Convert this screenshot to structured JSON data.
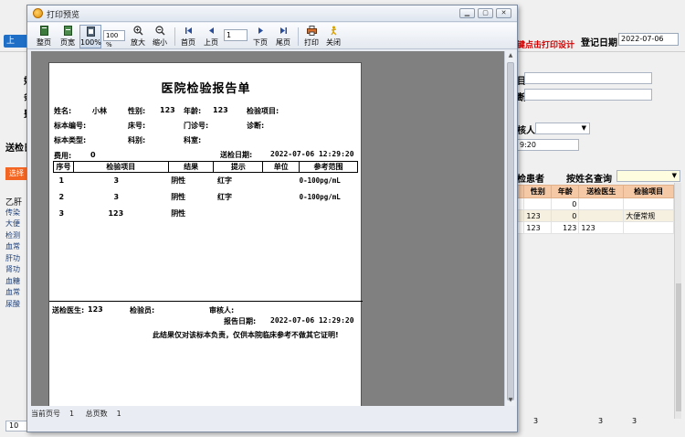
{
  "background": {
    "back_button": "上",
    "hint_text": "键点击打印设计",
    "register_date_label": "登记日期",
    "register_date_value": "2022-07-06",
    "time_value": "9:20",
    "left_header": "选择",
    "left_items": [
      "乙肝",
      "传染",
      "大便",
      "检测",
      "血常",
      "肝功",
      "肾功",
      "血糖",
      "血常",
      "尿酸"
    ],
    "pager_value": "10",
    "query_label_1": "检患者",
    "query_label_2": "按姓名查询",
    "grid_headers": [
      "",
      "性别",
      "年龄",
      "送检医生",
      "检验项目"
    ],
    "grid_rows": [
      [
        "",
        "",
        "0",
        "",
        ""
      ],
      [
        "",
        "123",
        "0",
        "",
        "大便常规"
      ],
      [
        "",
        "123",
        "123",
        "123",
        ""
      ]
    ],
    "bottom_values": [
      "3",
      "3",
      "3"
    ],
    "fragments": {
      "left_col": [
        "姓",
        "条",
        "费"
      ],
      "right_col": [
        "目",
        "断"
      ],
      "mid": "核人",
      "send_label": "送检日"
    }
  },
  "window": {
    "title": "打印预览",
    "buttons": {
      "minimize": "▁",
      "maximize": "▢",
      "close": "✕"
    },
    "toolbar": {
      "whole_page": "整页",
      "page_width": "页宽",
      "hundred": "100%",
      "zoom_value": "100 %",
      "zoom_in": "放大",
      "zoom_out": "缩小",
      "first_page": "首页",
      "prev_page": "上页",
      "page_number": "1",
      "next_page": "下页",
      "last_page": "尾页",
      "print": "打印",
      "close": "关闭"
    },
    "status": {
      "current_page": "当前页号",
      "current_page_value": "1",
      "total_pages": "总页数",
      "total_pages_value": "1"
    }
  },
  "report": {
    "title": "医院检验报告单",
    "name_label": "姓名:",
    "name_value": "小林",
    "gender_label": "性别:",
    "gender_value": "123",
    "age_label": "年龄:",
    "age_value": "123",
    "items_label": "检验项目:",
    "sample_no_label": "标本编号:",
    "bed_label": "床号:",
    "clinic_label": "门诊号:",
    "diagnosis_label": "诊断:",
    "sample_type_label": "标本类型:",
    "dept_label": "科别:",
    "room_label": "科室:",
    "fee_label": "费用:",
    "fee_value": "0",
    "send_date_label": "送检日期:",
    "send_date_value": "2022-07-06 12:29:20",
    "table_headers": [
      "序号",
      "检验项目",
      "结果",
      "提示",
      "单位",
      "参考范围"
    ],
    "table_rows": [
      [
        "1",
        "3",
        "阴性",
        "红字",
        "",
        "0-100pg/mL"
      ],
      [
        "2",
        "3",
        "阴性",
        "红字",
        "",
        "0-100pg/mL"
      ],
      [
        "3",
        "123",
        "阴性",
        "",
        "",
        ""
      ]
    ],
    "send_doctor_label": "送检医生:",
    "send_doctor_value": "123",
    "inspector_label": "检验员:",
    "reviewer_label": "审核人:",
    "report_date_label": "报告日期:",
    "report_date_value": "2022-07-06 12:29:20",
    "disclaimer": "此结果仅对该标本负责，仅供本院临床参考不做其它证明!"
  }
}
